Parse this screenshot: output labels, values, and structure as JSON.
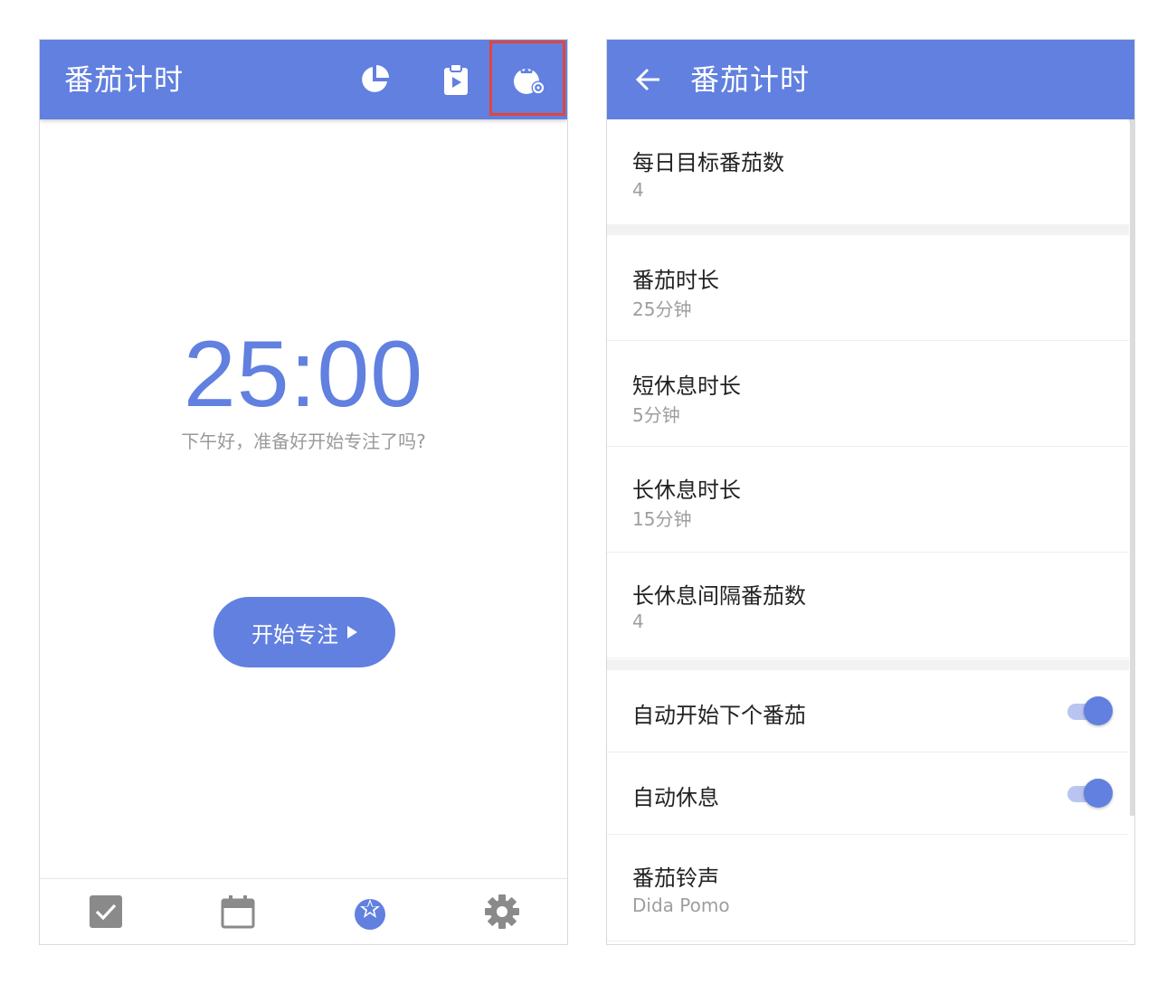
{
  "left_screen": {
    "title": "番茄计时",
    "timer": "25:00",
    "greeting": "下午好，准备好开始专注了吗?",
    "start_button": "开始专注",
    "header_icons": [
      "pie-chart-icon",
      "clipboard-play-icon",
      "tomato-settings-icon"
    ],
    "bottom_nav": [
      "checkbox-icon",
      "calendar-icon",
      "tomato-icon",
      "gear-icon"
    ],
    "active_nav": "tomato-icon"
  },
  "right_screen": {
    "title": "番茄计时",
    "settings": [
      {
        "label": "每日目标番茄数",
        "value": "4"
      },
      {
        "label": "番茄时长",
        "value": "25分钟"
      },
      {
        "label": "短休息时长",
        "value": "5分钟"
      },
      {
        "label": "长休息时长",
        "value": "15分钟"
      },
      {
        "label": "长休息间隔番茄数",
        "value": "4"
      },
      {
        "label": "自动开始下个番茄",
        "toggle": true
      },
      {
        "label": "自动休息",
        "toggle": true
      },
      {
        "label": "番茄铃声",
        "value": "Dida Pomo"
      }
    ]
  },
  "colors": {
    "accent": "#6180e0",
    "highlight": "#e2463a",
    "secondary_text": "#9e9e9e",
    "icon_gray": "#8a8a8a"
  }
}
